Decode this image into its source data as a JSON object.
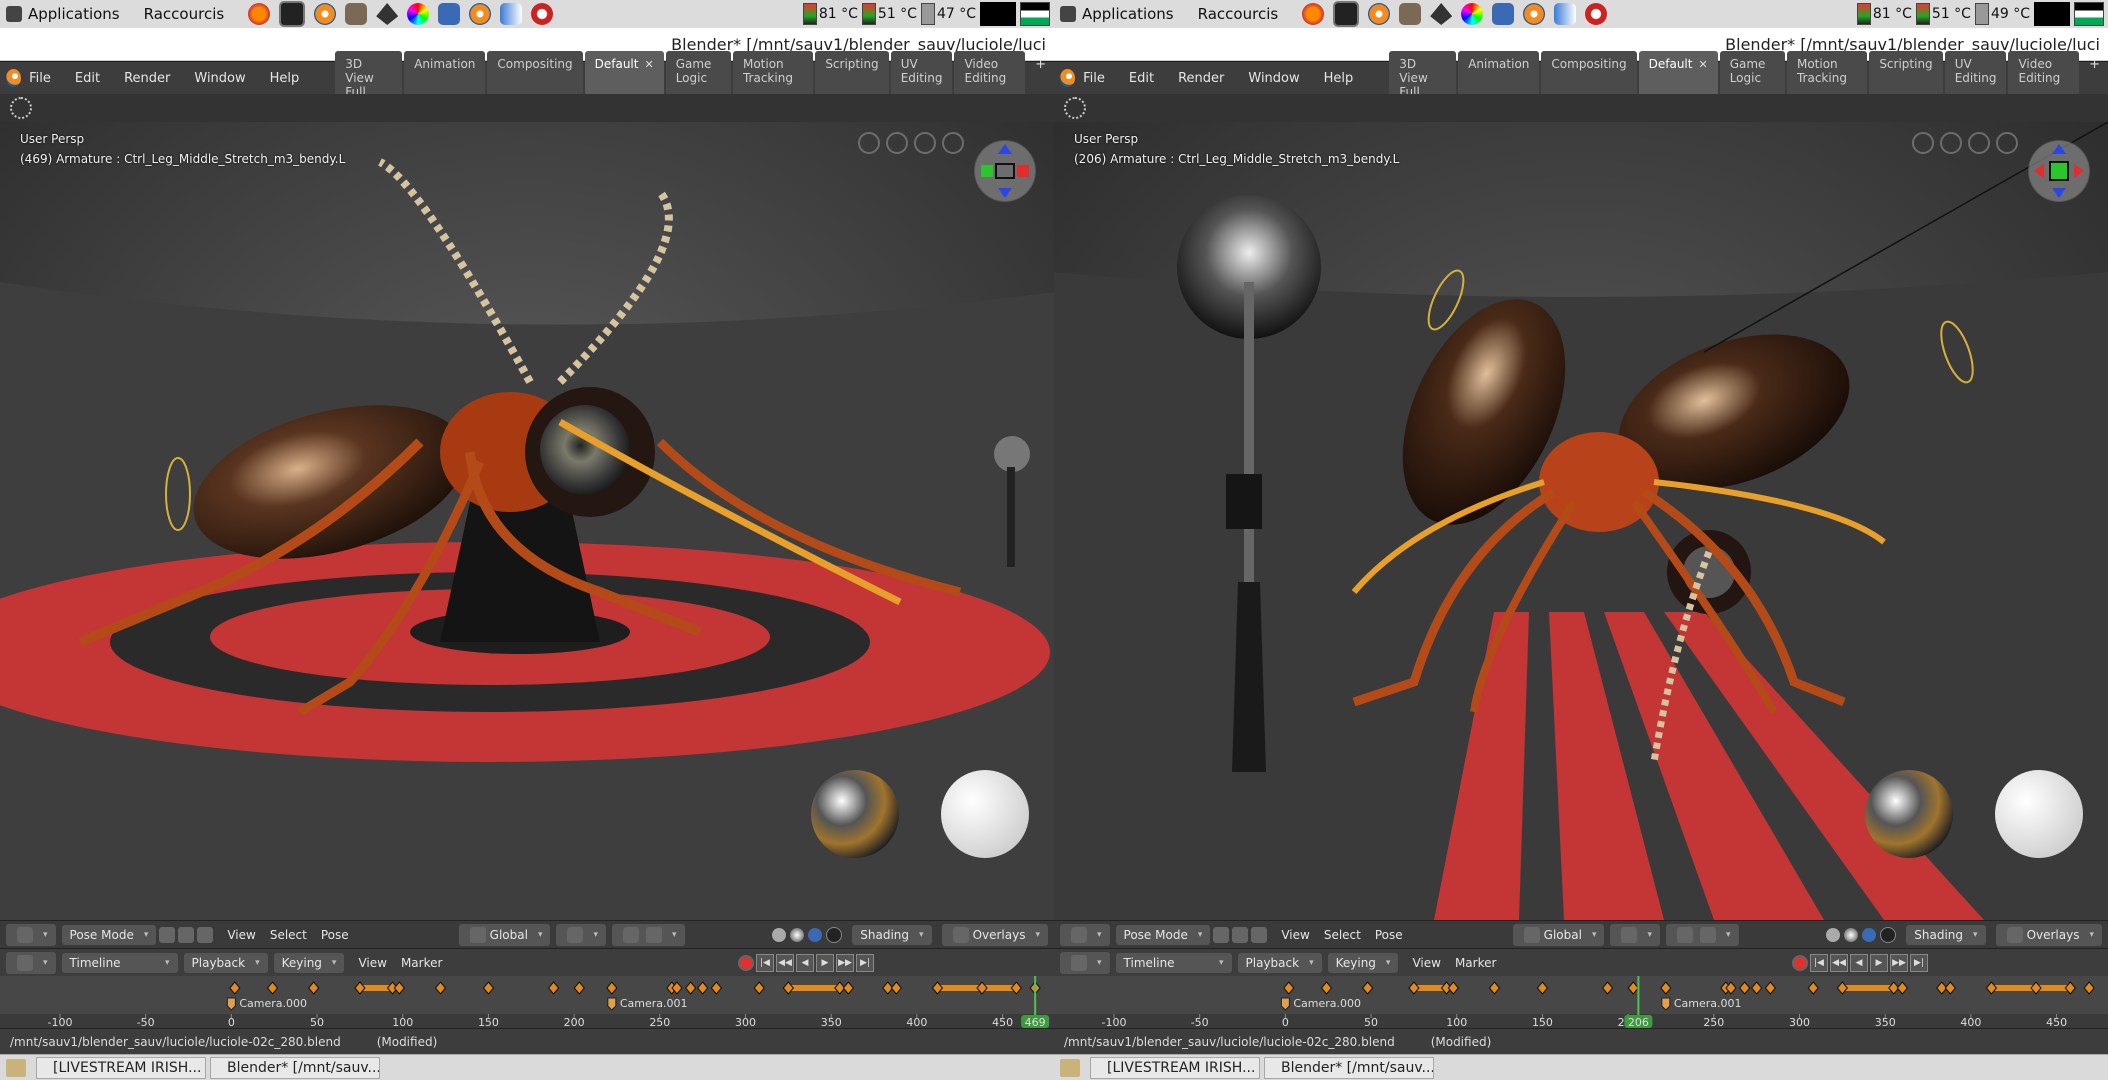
{
  "system_panel": {
    "applications": "Applications",
    "shortcuts": "Raccourcis",
    "left_temps": [
      "81 °C",
      "51 °C",
      "47 °C"
    ],
    "right_temps": [
      "81 °C",
      "51 °C",
      "49 °C"
    ]
  },
  "window_title": "Blender* [/mnt/sauv1/blender_sauv/luciole/luci",
  "blender": {
    "menus": [
      "File",
      "Edit",
      "Render",
      "Window",
      "Help"
    ],
    "workspaces": [
      "3D View Full",
      "Animation",
      "Compositing",
      "Default",
      "Game Logic",
      "Motion Tracking",
      "Scripting",
      "UV Editing",
      "Video Editing"
    ],
    "active_workspace": "Default",
    "add_tab": "+",
    "close_tab": "✕"
  },
  "viewports": {
    "left": {
      "persp": "User Persp",
      "info": "(469) Armature : Ctrl_Leg_Middle_Stretch_m3_bendy.L"
    },
    "right": {
      "persp": "User Persp",
      "info": "(206) Armature : Ctrl_Leg_Middle_Stretch_m3_bendy.L"
    }
  },
  "view_header": {
    "mode": "Pose Mode",
    "menus": [
      "View",
      "Select",
      "Pose"
    ],
    "orientation": "Global",
    "shading": "Shading",
    "overlays": "Overlays"
  },
  "timeline_header": {
    "editor": "Timeline",
    "menus_a": [
      "Playback",
      "Keying"
    ],
    "menus_b": [
      "View",
      "Marker"
    ]
  },
  "timeline": {
    "ticks": [
      -100,
      -50,
      0,
      50,
      100,
      150,
      200,
      250,
      300,
      350,
      400,
      450
    ],
    "frame_min": -135,
    "frame_max": 480,
    "left_current_frame": 469,
    "right_current_frame": 206,
    "markers": [
      {
        "label": "Camera.000",
        "frame": 0
      },
      {
        "label": "Camera.001",
        "frame": 222
      }
    ],
    "keyframes": [
      2,
      24,
      48,
      75,
      94,
      98,
      122,
      150,
      188,
      203,
      222,
      257,
      260,
      268,
      275,
      283,
      308,
      325,
      355,
      360,
      383,
      388,
      412,
      438,
      458,
      469
    ],
    "holds": [
      [
        75,
        94
      ],
      [
        325,
        355
      ],
      [
        412,
        458
      ]
    ]
  },
  "status": {
    "path": "/mnt/sauv1/blender_sauv/luciole/luciole-02c_280.blend",
    "modified": "(Modified)"
  },
  "taskbar": {
    "items": [
      "[LIVESTREAM IRISH...",
      "Blender* [/mnt/sauv..."
    ]
  }
}
